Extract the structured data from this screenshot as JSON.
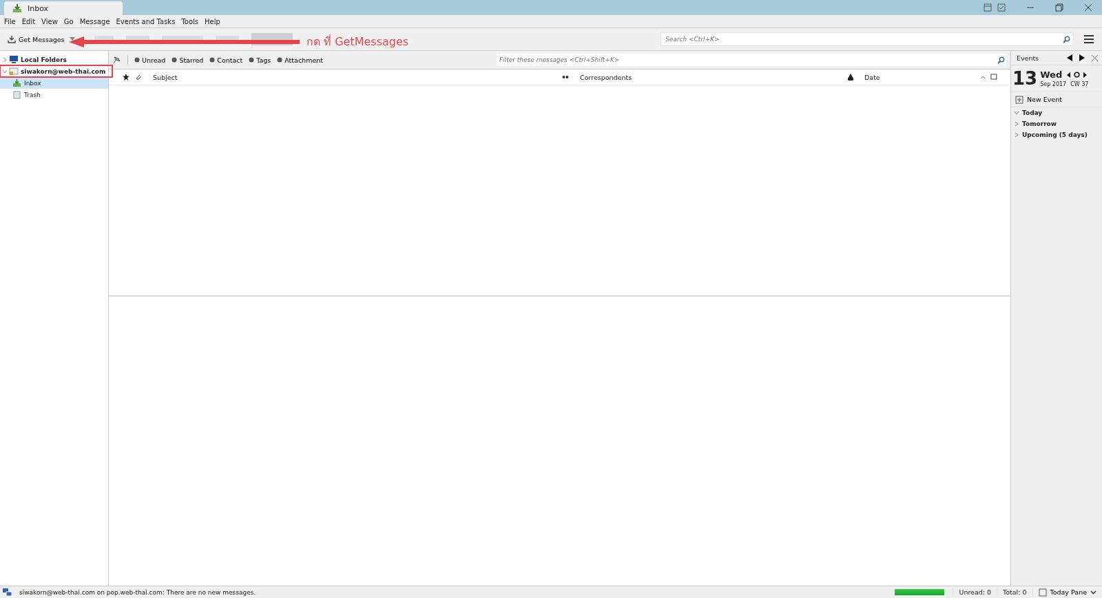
{
  "window": {
    "tab_title": "Inbox"
  },
  "menu": [
    "File",
    "Edit",
    "View",
    "Go",
    "Message",
    "Events and Tasks",
    "Tools",
    "Help"
  ],
  "toolbar": {
    "get_messages": "Get Messages",
    "search_placeholder": "Search <Ctrl+K>"
  },
  "annotation": {
    "text": "กด ที่ GetMessages"
  },
  "folders": [
    {
      "name": "Local Folders",
      "kind": "local",
      "expanded": false,
      "selected": false,
      "highlighted": false
    },
    {
      "name": "siwakorn@web-thai.com",
      "kind": "account",
      "expanded": true,
      "selected": false,
      "highlighted": true,
      "children": [
        {
          "name": "Inbox",
          "kind": "inbox",
          "selected": true
        },
        {
          "name": "Trash",
          "kind": "trash",
          "selected": false
        }
      ]
    }
  ],
  "quick_filter": {
    "buttons": [
      "Unread",
      "Starred",
      "Contact",
      "Tags",
      "Attachment"
    ],
    "placeholder": "Filter these messages <Ctrl+Shift+K>"
  },
  "columns": [
    "Subject",
    "Correspondents",
    "Date"
  ],
  "today_pane": {
    "title": "Events",
    "day": "13",
    "weekday": "Wed",
    "month_year": "Sep 2017",
    "week": "CW 37",
    "new_event": "New Event",
    "groups": [
      {
        "label": "Today",
        "expanded": true
      },
      {
        "label": "Tomorrow",
        "expanded": false
      },
      {
        "label": "Upcoming (5 days)",
        "expanded": false
      }
    ]
  },
  "status_bar": {
    "message": "siwakorn@web-thai.com on pop.web-thai.com: There are no new messages.",
    "level": 1,
    "unread": "Unread: 0",
    "total": "Total: 0",
    "today_pane": "Today Pane"
  }
}
